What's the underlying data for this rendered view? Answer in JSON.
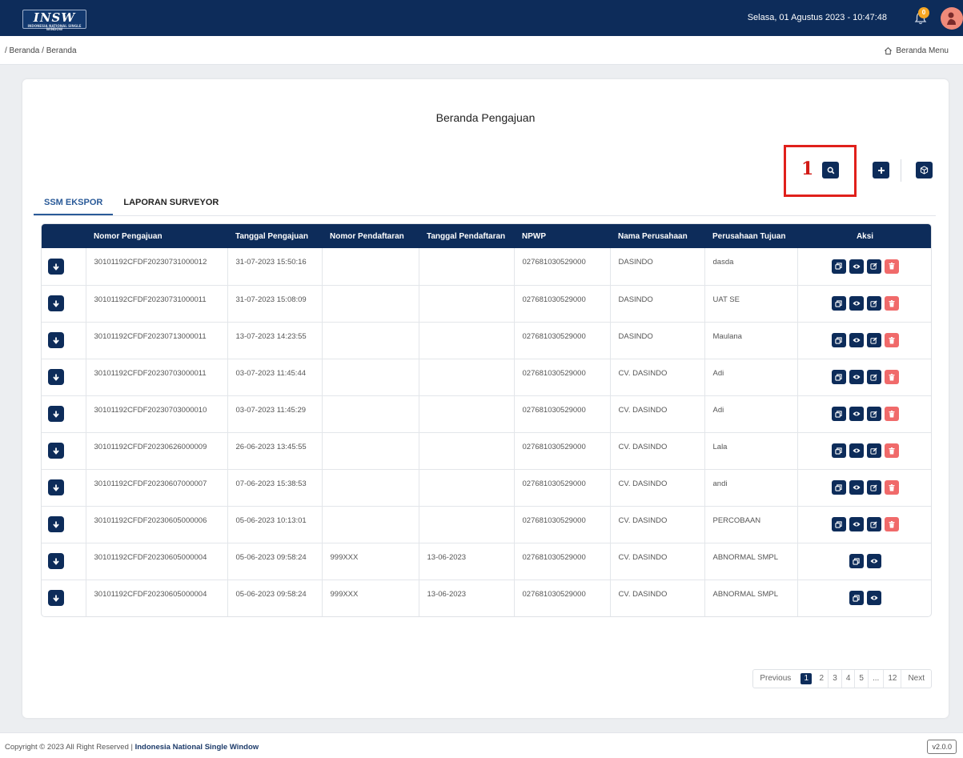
{
  "header": {
    "logo_text": "INSW",
    "logo_sub": "INDONESIA NATIONAL SINGLE WINDOW",
    "datetime": "Selasa, 01 Agustus 2023 - 10:47:48",
    "notif_count": "0"
  },
  "breadcrumb": "/ Beranda / Beranda",
  "home_menu": "Beranda Menu",
  "page_title": "Beranda Pengajuan",
  "annotation": "1",
  "tabs": [
    "SSM EKSPOR",
    "LAPORAN SURVEYOR"
  ],
  "columns": [
    "",
    "Nomor Pengajuan",
    "Tanggal Pengajuan",
    "Nomor Pendaftaran",
    "Tanggal Pendaftaran",
    "NPWP",
    "Nama Perusahaan",
    "Perusahaan Tujuan",
    "Aksi"
  ],
  "rows": [
    {
      "nomor": "30101192CFDF20230731000012",
      "tgl": "31-07-2023 15:50:16",
      "no_daftar": "",
      "tgl_daftar": "",
      "npwp": "027681030529000",
      "nama": "DASINDO",
      "tujuan": "dasda",
      "full_actions": true
    },
    {
      "nomor": "30101192CFDF20230731000011",
      "tgl": "31-07-2023 15:08:09",
      "no_daftar": "",
      "tgl_daftar": "",
      "npwp": "027681030529000",
      "nama": "DASINDO",
      "tujuan": "UAT SE",
      "full_actions": true
    },
    {
      "nomor": "30101192CFDF20230713000011",
      "tgl": "13-07-2023 14:23:55",
      "no_daftar": "",
      "tgl_daftar": "",
      "npwp": "027681030529000",
      "nama": "DASINDO",
      "tujuan": "Maulana",
      "full_actions": true
    },
    {
      "nomor": "30101192CFDF20230703000011",
      "tgl": "03-07-2023 11:45:44",
      "no_daftar": "",
      "tgl_daftar": "",
      "npwp": "027681030529000",
      "nama": "CV. DASINDO",
      "tujuan": "Adi",
      "full_actions": true
    },
    {
      "nomor": "30101192CFDF20230703000010",
      "tgl": "03-07-2023 11:45:29",
      "no_daftar": "",
      "tgl_daftar": "",
      "npwp": "027681030529000",
      "nama": "CV. DASINDO",
      "tujuan": "Adi",
      "full_actions": true
    },
    {
      "nomor": "30101192CFDF20230626000009",
      "tgl": "26-06-2023 13:45:55",
      "no_daftar": "",
      "tgl_daftar": "",
      "npwp": "027681030529000",
      "nama": "CV. DASINDO",
      "tujuan": "Lala",
      "full_actions": true
    },
    {
      "nomor": "30101192CFDF20230607000007",
      "tgl": "07-06-2023 15:38:53",
      "no_daftar": "",
      "tgl_daftar": "",
      "npwp": "027681030529000",
      "nama": "CV. DASINDO",
      "tujuan": "andi",
      "full_actions": true
    },
    {
      "nomor": "30101192CFDF20230605000006",
      "tgl": "05-06-2023 10:13:01",
      "no_daftar": "",
      "tgl_daftar": "",
      "npwp": "027681030529000",
      "nama": "CV. DASINDO",
      "tujuan": "PERCOBAAN",
      "full_actions": true
    },
    {
      "nomor": "30101192CFDF20230605000004",
      "tgl": "05-06-2023 09:58:24",
      "no_daftar": "999XXX",
      "tgl_daftar": "13-06-2023",
      "npwp": "027681030529000",
      "nama": "CV. DASINDO",
      "tujuan": "ABNORMAL SMPL",
      "full_actions": false
    },
    {
      "nomor": "30101192CFDF20230605000004",
      "tgl": "05-06-2023 09:58:24",
      "no_daftar": "999XXX",
      "tgl_daftar": "13-06-2023",
      "npwp": "027681030529000",
      "nama": "CV. DASINDO",
      "tujuan": "ABNORMAL SMPL",
      "full_actions": false
    }
  ],
  "pagination": {
    "previous": "Previous",
    "pages": [
      "1",
      "2",
      "3",
      "4",
      "5",
      "...",
      "12"
    ],
    "active": "1",
    "next": "Next"
  },
  "footer": {
    "copyright": "Copyright © 2023 All Right Reserved |",
    "org": "Indonesia National Single Window",
    "version": "v2.0.0"
  },
  "colors": {
    "navy": "#0d2c5a",
    "accent_tab": "#2a5a98",
    "delete_red": "#f06a6a",
    "annotation_red": "#e0201b"
  }
}
